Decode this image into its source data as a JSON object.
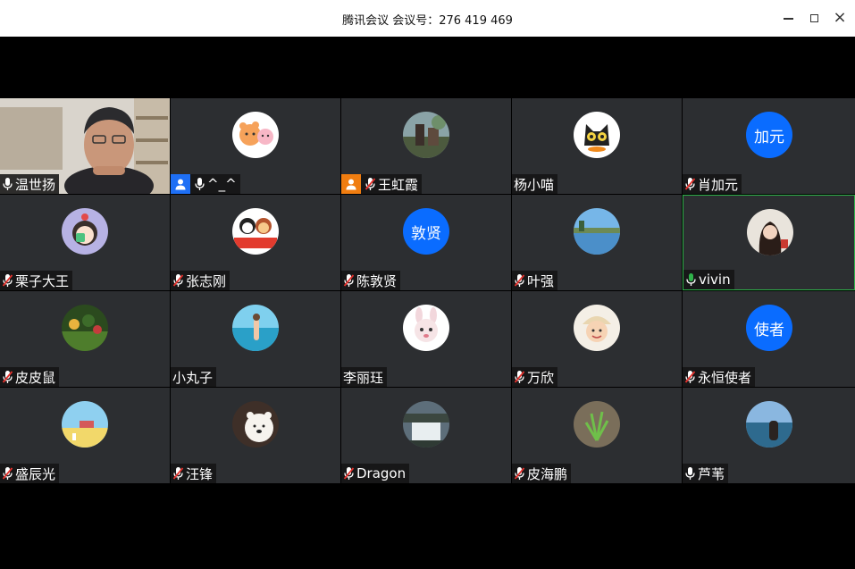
{
  "window": {
    "title": "腾讯会议 会议号：276 419 469"
  },
  "participants": [
    {
      "name": "温世扬",
      "mic": "on",
      "kind": "video"
    },
    {
      "name": "^_^",
      "mic": "on",
      "kind": "avatar",
      "avatar": "bear-cartoon-icon",
      "host_badge": "blue"
    },
    {
      "name": "王虹霞",
      "mic": "muted",
      "kind": "avatar",
      "avatar": "photo-garden-icon",
      "host_badge": "orange"
    },
    {
      "name": "杨小喵",
      "mic": "none",
      "kind": "avatar",
      "avatar": "cat-cartoon-icon"
    },
    {
      "name": "肖加元",
      "mic": "muted",
      "kind": "text",
      "avatar_text": "加元"
    },
    {
      "name": "栗子大王",
      "mic": "muted",
      "kind": "avatar",
      "avatar": "cartoon-girl-icon"
    },
    {
      "name": "张志刚",
      "mic": "muted",
      "kind": "avatar",
      "avatar": "wuhan-jiayou-icon",
      "avatar_caption": "武汉加油"
    },
    {
      "name": "陈敦贤",
      "mic": "muted",
      "kind": "text",
      "avatar_text": "敦贤"
    },
    {
      "name": "叶强",
      "mic": "muted",
      "kind": "avatar",
      "avatar": "lake-landscape-icon"
    },
    {
      "name": "vivin",
      "mic": "speaking",
      "kind": "avatar",
      "avatar": "girl-photo-icon",
      "active": true
    },
    {
      "name": "皮皮鼠",
      "mic": "muted",
      "kind": "avatar",
      "avatar": "flowers-garden-icon"
    },
    {
      "name": "小丸子",
      "mic": "none",
      "kind": "avatar",
      "avatar": "beach-photo-icon"
    },
    {
      "name": "李丽珏",
      "mic": "none",
      "kind": "avatar",
      "avatar": "bunny-girl-icon"
    },
    {
      "name": "万欣",
      "mic": "muted",
      "kind": "avatar",
      "avatar": "child-photo-icon"
    },
    {
      "name": "永恒使者",
      "mic": "muted",
      "kind": "text",
      "avatar_text": "使者"
    },
    {
      "name": "盛辰光",
      "mic": "muted",
      "kind": "avatar",
      "avatar": "sunny-field-icon"
    },
    {
      "name": "汪锋",
      "mic": "muted",
      "kind": "avatar",
      "avatar": "polar-bear-icon"
    },
    {
      "name": "Dragon",
      "mic": "muted",
      "kind": "avatar",
      "avatar": "waterfall-icon"
    },
    {
      "name": "皮海鹏",
      "mic": "muted",
      "kind": "avatar",
      "avatar": "plant-photo-icon"
    },
    {
      "name": "芦苇",
      "mic": "on",
      "kind": "avatar",
      "avatar": "seaside-photo-icon"
    }
  ],
  "colors": {
    "tile": "#2c2e31",
    "text_avatar": "#0a6cff",
    "active_border": "#2fb24a",
    "muted_slash": "#e5322d",
    "speaking": "#2fb24a"
  }
}
